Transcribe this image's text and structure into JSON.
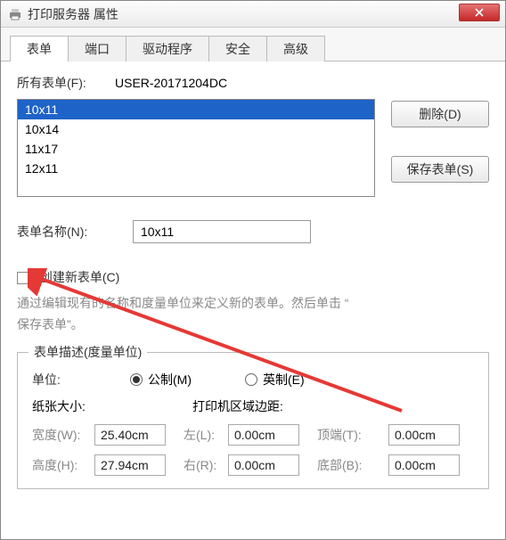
{
  "window": {
    "title": "打印服务器 属性"
  },
  "tabs": [
    "表单",
    "端口",
    "驱动程序",
    "安全",
    "高级"
  ],
  "forms_label": "所有表单(F):",
  "server_name": "USER-20171204DC",
  "form_list": [
    "10x11",
    "10x14",
    "11x17",
    "12x11"
  ],
  "selected_form_index": 0,
  "buttons": {
    "delete": "删除(D)",
    "save": "保存表单(S)"
  },
  "form_name_label": "表单名称(N):",
  "form_name_value": "10x11",
  "create_checkbox_label": "创建新表单(C)",
  "info_line1": "通过编辑现有的名称和度量单位来定义新的表单。然后单击 “",
  "info_line2": "保存表单”。",
  "fieldset_legend": "表单描述(度量单位)",
  "unit_label": "单位:",
  "unit_metric": "公制(M)",
  "unit_imperial": "英制(E)",
  "paper_size_label": "纸张大小:",
  "margins_label": "打印机区域边距:",
  "width_label": "宽度(W):",
  "height_label": "高度(H):",
  "left_label": "左(L):",
  "right_label": "右(R):",
  "top_label": "顶端(T):",
  "bottom_label": "底部(B):",
  "width_value": "25.40cm",
  "height_value": "27.94cm",
  "left_value": "0.00cm",
  "right_value": "0.00cm",
  "top_value": "0.00cm",
  "bottom_value": "0.00cm"
}
